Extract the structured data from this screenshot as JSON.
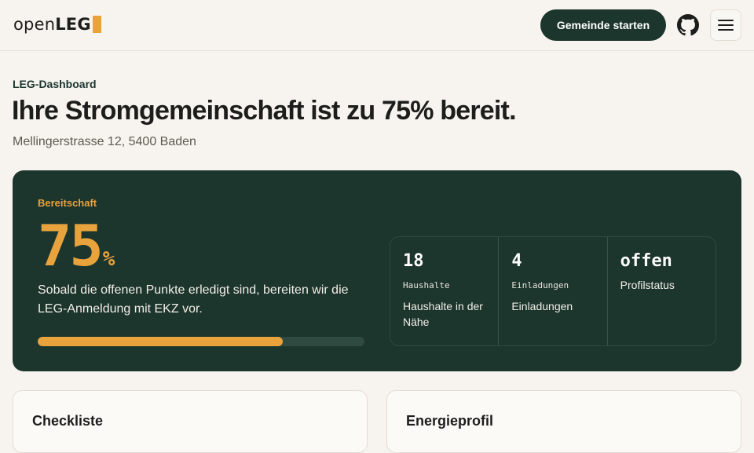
{
  "header": {
    "logo_a": "open",
    "logo_b": "LEG",
    "cta_label": "Gemeinde starten",
    "github_icon": "github-icon",
    "menu_icon": "hamburger-menu-icon"
  },
  "page": {
    "eyebrow": "LEG-Dashboard",
    "title": "Ihre Stromgemeinschaft ist zu 75% bereit.",
    "address": "Mellingerstrasse 12, 5400 Baden"
  },
  "readiness": {
    "label": "Bereitschaft",
    "value": "75",
    "unit": "%",
    "progress_fraction": 0.75,
    "description": "Sobald die offenen Punkte erledigt sind, bereiten wir die LEG-Anmeldung mit EKZ vor.",
    "stats": [
      {
        "value": "18",
        "key": "Haushalte",
        "sub": "Haushalte in der Nähe"
      },
      {
        "value": "4",
        "key": "Einladungen",
        "sub": "Einladungen"
      },
      {
        "value": "offen",
        "key": "",
        "sub": "Profilstatus"
      }
    ]
  },
  "panels": {
    "checklist_title": "Checkliste",
    "energy_title": "Energieprofil"
  },
  "colors": {
    "accent": "#e8a33d",
    "brand_dark": "#1c352d",
    "background": "#f7f4ef"
  }
}
